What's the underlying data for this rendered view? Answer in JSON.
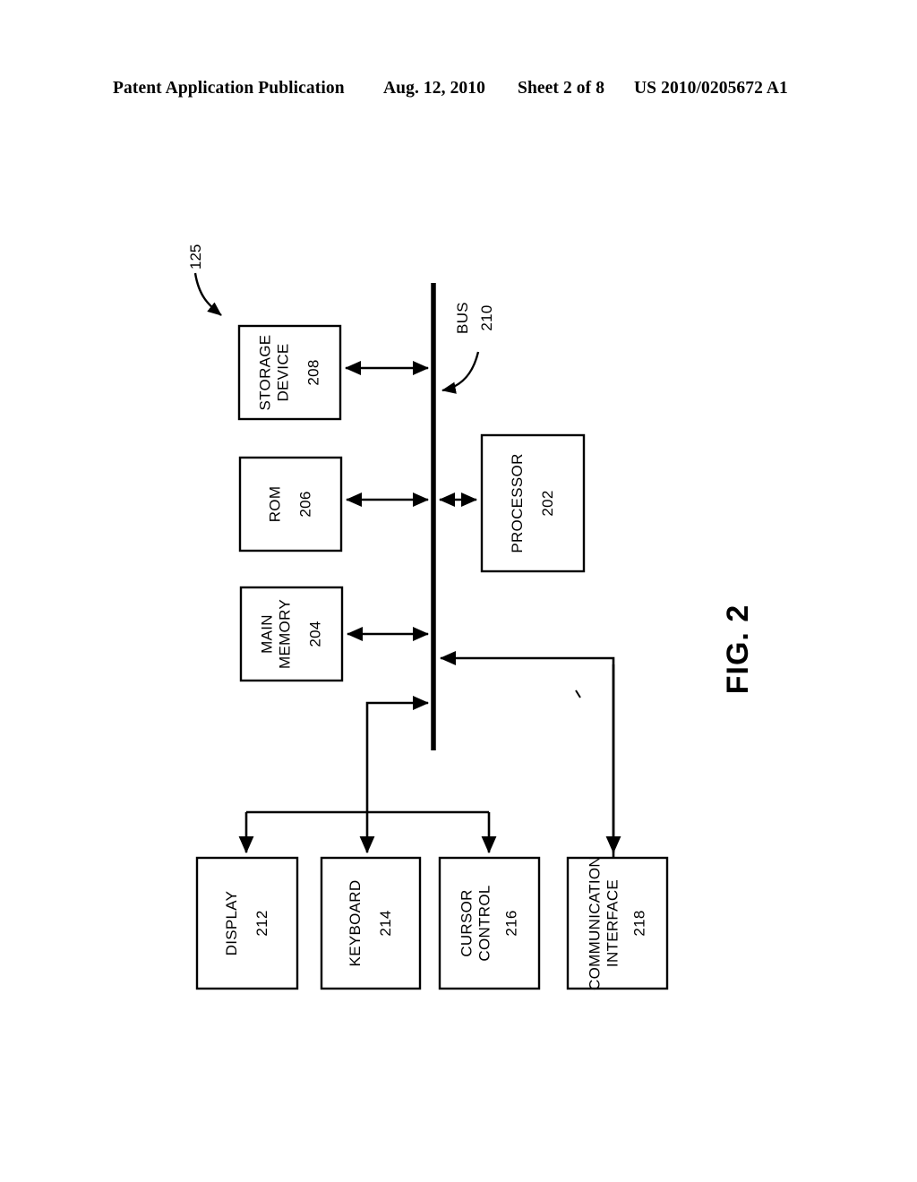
{
  "header": {
    "publication": "Patent Application Publication",
    "date": "Aug. 12, 2010",
    "sheet": "Sheet 2 of 8",
    "patent_number": "US 2010/0205672 A1"
  },
  "figure": {
    "label": "FIG. 2",
    "system_ref": "125"
  },
  "bus": {
    "title": "BUS",
    "number": "210"
  },
  "blocks": [
    {
      "id": "storage-device",
      "title": "STORAGE\nDEVICE",
      "title_lines": [
        "STORAGE",
        "DEVICE"
      ],
      "number": "208"
    },
    {
      "id": "rom",
      "title": "ROM",
      "title_lines": [
        "ROM"
      ],
      "number": "206"
    },
    {
      "id": "main-memory",
      "title": "MAIN\nMEMORY",
      "title_lines": [
        "MAIN",
        "MEMORY"
      ],
      "number": "204"
    },
    {
      "id": "processor",
      "title": "PROCESSOR",
      "title_lines": [
        "PROCESSOR"
      ],
      "number": "202"
    },
    {
      "id": "display",
      "title": "DISPLAY",
      "title_lines": [
        "DISPLAY"
      ],
      "number": "212"
    },
    {
      "id": "keyboard",
      "title": "KEYBOARD",
      "title_lines": [
        "KEYBOARD"
      ],
      "number": "214"
    },
    {
      "id": "cursor-control",
      "title": "CURSOR\nCONTROL",
      "title_lines": [
        "CURSOR",
        "CONTROL"
      ],
      "number": "216"
    },
    {
      "id": "communication-interface",
      "title": "COMMUNICATION\nINTERFACE",
      "title_lines": [
        "COMMUNICATION",
        "INTERFACE"
      ],
      "number": "218"
    }
  ],
  "colors": {
    "ink": "#000000",
    "paper": "#ffffff"
  }
}
